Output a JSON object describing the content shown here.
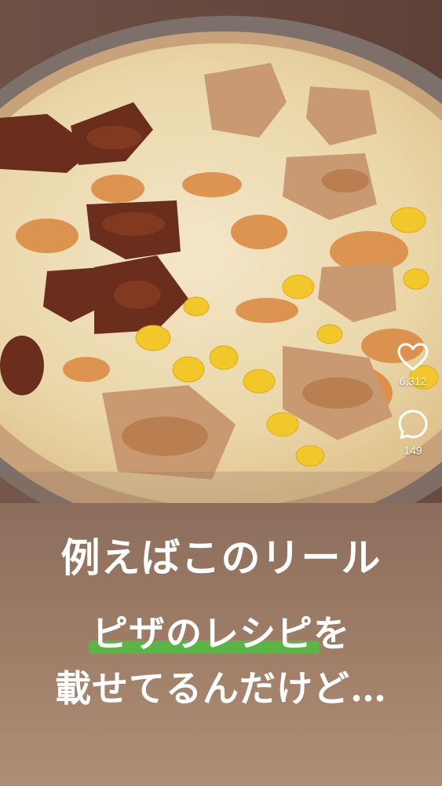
{
  "post": {
    "image_alt": "pizza with chicken, bacon, corn and melted cheese",
    "likes": "6,312",
    "comments": "149"
  },
  "caption": {
    "line1": "例えばこのリール",
    "line2_highlight": "ピザのレシピ",
    "line2_rest": "を",
    "line3": "載せてるんだけど…"
  },
  "colors": {
    "highlight": "#5bb446",
    "caption_bg": "#9c7a64",
    "text": "#ffffff"
  },
  "icons": [
    "heart-icon",
    "comment-icon"
  ]
}
